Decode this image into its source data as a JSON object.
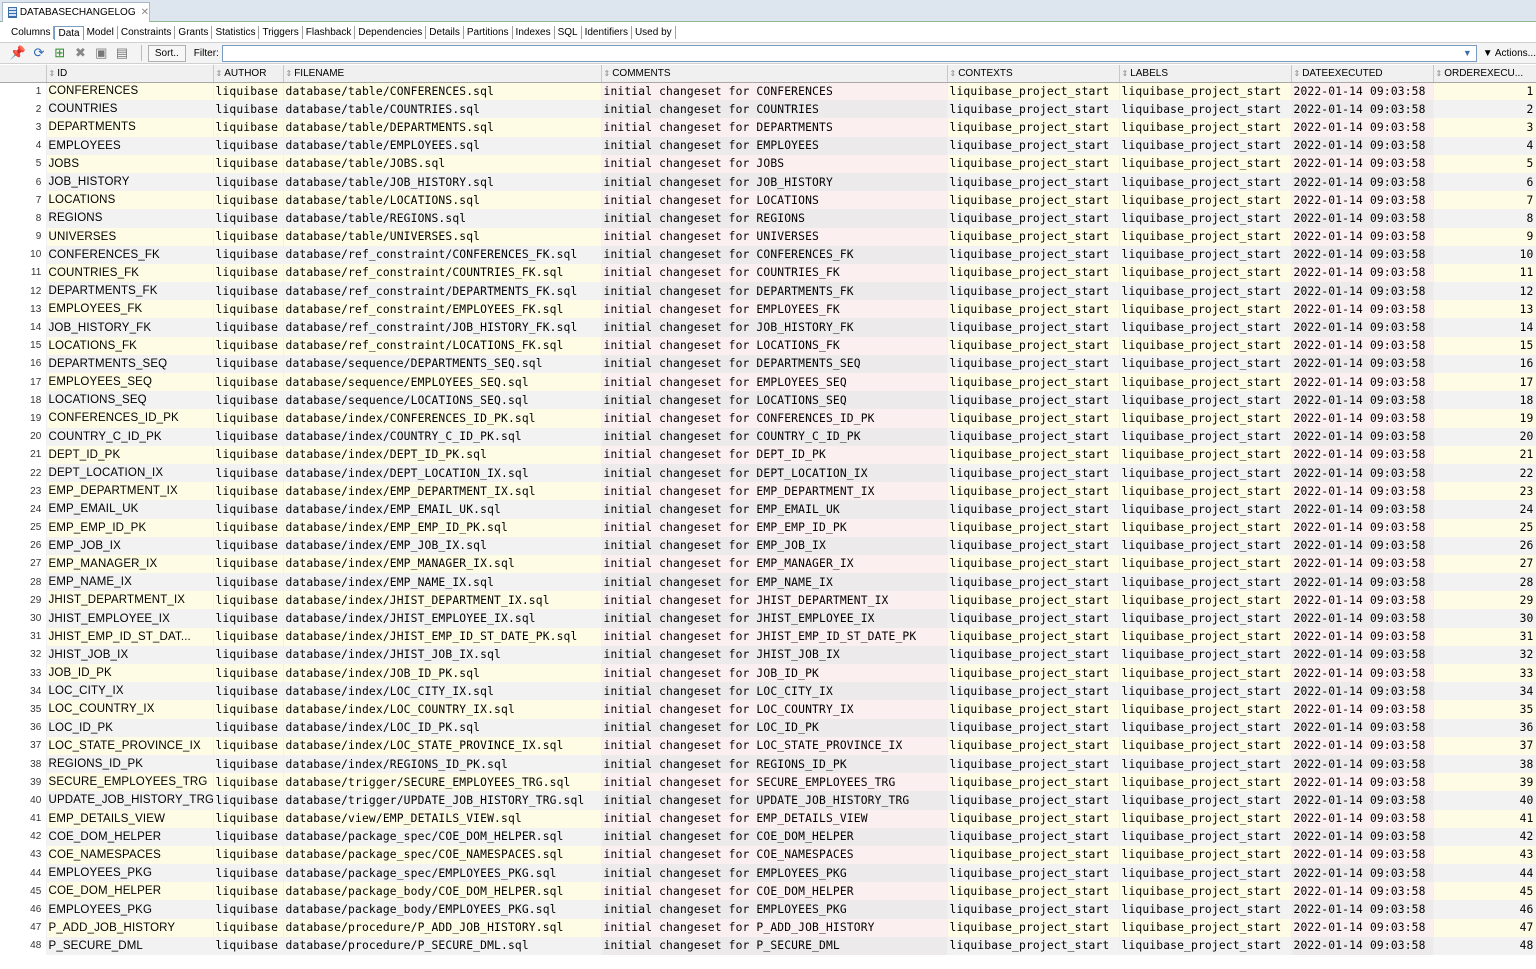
{
  "document_tab": {
    "title": "DATABASECHANGELOG"
  },
  "view_tabs": [
    "Columns",
    "Data",
    "Model",
    "Constraints",
    "Grants",
    "Statistics",
    "Triggers",
    "Flashback",
    "Dependencies",
    "Details",
    "Partitions",
    "Indexes",
    "SQL",
    "Identifiers",
    "Used by"
  ],
  "active_view_tab": "Data",
  "toolbar": {
    "sort_label": "Sort..",
    "filter_label": "Filter:",
    "filter_value": "",
    "actions_label": "Actions..."
  },
  "columns": [
    "ID",
    "AUTHOR",
    "FILENAME",
    "COMMENTS",
    "CONTEXTS",
    "LABELS",
    "DATEEXECUTED",
    "ORDEREXECU..."
  ],
  "rows": [
    {
      "n": "1",
      "id": "CONFERENCES",
      "author": "liquibase",
      "filename": "database/table/CONFERENCES.sql",
      "comments": "initial changeset for CONFERENCES",
      "contexts": "liquibase_project_start",
      "labels": "liquibase_project_start",
      "dateexecuted": "2022-01-14 09:03:58",
      "order": "1"
    },
    {
      "n": "2",
      "id": "COUNTRIES",
      "author": "liquibase",
      "filename": "database/table/COUNTRIES.sql",
      "comments": "initial changeset for COUNTRIES",
      "contexts": "liquibase_project_start",
      "labels": "liquibase_project_start",
      "dateexecuted": "2022-01-14 09:03:58",
      "order": "2"
    },
    {
      "n": "3",
      "id": "DEPARTMENTS",
      "author": "liquibase",
      "filename": "database/table/DEPARTMENTS.sql",
      "comments": "initial changeset for DEPARTMENTS",
      "contexts": "liquibase_project_start",
      "labels": "liquibase_project_start",
      "dateexecuted": "2022-01-14 09:03:58",
      "order": "3"
    },
    {
      "n": "4",
      "id": "EMPLOYEES",
      "author": "liquibase",
      "filename": "database/table/EMPLOYEES.sql",
      "comments": "initial changeset for EMPLOYEES",
      "contexts": "liquibase_project_start",
      "labels": "liquibase_project_start",
      "dateexecuted": "2022-01-14 09:03:58",
      "order": "4"
    },
    {
      "n": "5",
      "id": "JOBS",
      "author": "liquibase",
      "filename": "database/table/JOBS.sql",
      "comments": "initial changeset for JOBS",
      "contexts": "liquibase_project_start",
      "labels": "liquibase_project_start",
      "dateexecuted": "2022-01-14 09:03:58",
      "order": "5"
    },
    {
      "n": "6",
      "id": "JOB_HISTORY",
      "author": "liquibase",
      "filename": "database/table/JOB_HISTORY.sql",
      "comments": "initial changeset for JOB_HISTORY",
      "contexts": "liquibase_project_start",
      "labels": "liquibase_project_start",
      "dateexecuted": "2022-01-14 09:03:58",
      "order": "6"
    },
    {
      "n": "7",
      "id": "LOCATIONS",
      "author": "liquibase",
      "filename": "database/table/LOCATIONS.sql",
      "comments": "initial changeset for LOCATIONS",
      "contexts": "liquibase_project_start",
      "labels": "liquibase_project_start",
      "dateexecuted": "2022-01-14 09:03:58",
      "order": "7"
    },
    {
      "n": "8",
      "id": "REGIONS",
      "author": "liquibase",
      "filename": "database/table/REGIONS.sql",
      "comments": "initial changeset for REGIONS",
      "contexts": "liquibase_project_start",
      "labels": "liquibase_project_start",
      "dateexecuted": "2022-01-14 09:03:58",
      "order": "8"
    },
    {
      "n": "9",
      "id": "UNIVERSES",
      "author": "liquibase",
      "filename": "database/table/UNIVERSES.sql",
      "comments": "initial changeset for UNIVERSES",
      "contexts": "liquibase_project_start",
      "labels": "liquibase_project_start",
      "dateexecuted": "2022-01-14 09:03:58",
      "order": "9"
    },
    {
      "n": "10",
      "id": "CONFERENCES_FK",
      "author": "liquibase",
      "filename": "database/ref_constraint/CONFERENCES_FK.sql",
      "comments": "initial changeset for CONFERENCES_FK",
      "contexts": "liquibase_project_start",
      "labels": "liquibase_project_start",
      "dateexecuted": "2022-01-14 09:03:58",
      "order": "10"
    },
    {
      "n": "11",
      "id": "COUNTRIES_FK",
      "author": "liquibase",
      "filename": "database/ref_constraint/COUNTRIES_FK.sql",
      "comments": "initial changeset for COUNTRIES_FK",
      "contexts": "liquibase_project_start",
      "labels": "liquibase_project_start",
      "dateexecuted": "2022-01-14 09:03:58",
      "order": "11"
    },
    {
      "n": "12",
      "id": "DEPARTMENTS_FK",
      "author": "liquibase",
      "filename": "database/ref_constraint/DEPARTMENTS_FK.sql",
      "comments": "initial changeset for DEPARTMENTS_FK",
      "contexts": "liquibase_project_start",
      "labels": "liquibase_project_start",
      "dateexecuted": "2022-01-14 09:03:58",
      "order": "12"
    },
    {
      "n": "13",
      "id": "EMPLOYEES_FK",
      "author": "liquibase",
      "filename": "database/ref_constraint/EMPLOYEES_FK.sql",
      "comments": "initial changeset for EMPLOYEES_FK",
      "contexts": "liquibase_project_start",
      "labels": "liquibase_project_start",
      "dateexecuted": "2022-01-14 09:03:58",
      "order": "13"
    },
    {
      "n": "14",
      "id": "JOB_HISTORY_FK",
      "author": "liquibase",
      "filename": "database/ref_constraint/JOB_HISTORY_FK.sql",
      "comments": "initial changeset for JOB_HISTORY_FK",
      "contexts": "liquibase_project_start",
      "labels": "liquibase_project_start",
      "dateexecuted": "2022-01-14 09:03:58",
      "order": "14"
    },
    {
      "n": "15",
      "id": "LOCATIONS_FK",
      "author": "liquibase",
      "filename": "database/ref_constraint/LOCATIONS_FK.sql",
      "comments": "initial changeset for LOCATIONS_FK",
      "contexts": "liquibase_project_start",
      "labels": "liquibase_project_start",
      "dateexecuted": "2022-01-14 09:03:58",
      "order": "15"
    },
    {
      "n": "16",
      "id": "DEPARTMENTS_SEQ",
      "author": "liquibase",
      "filename": "database/sequence/DEPARTMENTS_SEQ.sql",
      "comments": "initial changeset for DEPARTMENTS_SEQ",
      "contexts": "liquibase_project_start",
      "labels": "liquibase_project_start",
      "dateexecuted": "2022-01-14 09:03:58",
      "order": "16"
    },
    {
      "n": "17",
      "id": "EMPLOYEES_SEQ",
      "author": "liquibase",
      "filename": "database/sequence/EMPLOYEES_SEQ.sql",
      "comments": "initial changeset for EMPLOYEES_SEQ",
      "contexts": "liquibase_project_start",
      "labels": "liquibase_project_start",
      "dateexecuted": "2022-01-14 09:03:58",
      "order": "17"
    },
    {
      "n": "18",
      "id": "LOCATIONS_SEQ",
      "author": "liquibase",
      "filename": "database/sequence/LOCATIONS_SEQ.sql",
      "comments": "initial changeset for LOCATIONS_SEQ",
      "contexts": "liquibase_project_start",
      "labels": "liquibase_project_start",
      "dateexecuted": "2022-01-14 09:03:58",
      "order": "18"
    },
    {
      "n": "19",
      "id": "CONFERENCES_ID_PK",
      "author": "liquibase",
      "filename": "database/index/CONFERENCES_ID_PK.sql",
      "comments": "initial changeset for CONFERENCES_ID_PK",
      "contexts": "liquibase_project_start",
      "labels": "liquibase_project_start",
      "dateexecuted": "2022-01-14 09:03:58",
      "order": "19"
    },
    {
      "n": "20",
      "id": "COUNTRY_C_ID_PK",
      "author": "liquibase",
      "filename": "database/index/COUNTRY_C_ID_PK.sql",
      "comments": "initial changeset for COUNTRY_C_ID_PK",
      "contexts": "liquibase_project_start",
      "labels": "liquibase_project_start",
      "dateexecuted": "2022-01-14 09:03:58",
      "order": "20"
    },
    {
      "n": "21",
      "id": "DEPT_ID_PK",
      "author": "liquibase",
      "filename": "database/index/DEPT_ID_PK.sql",
      "comments": "initial changeset for DEPT_ID_PK",
      "contexts": "liquibase_project_start",
      "labels": "liquibase_project_start",
      "dateexecuted": "2022-01-14 09:03:58",
      "order": "21"
    },
    {
      "n": "22",
      "id": "DEPT_LOCATION_IX",
      "author": "liquibase",
      "filename": "database/index/DEPT_LOCATION_IX.sql",
      "comments": "initial changeset for DEPT_LOCATION_IX",
      "contexts": "liquibase_project_start",
      "labels": "liquibase_project_start",
      "dateexecuted": "2022-01-14 09:03:58",
      "order": "22"
    },
    {
      "n": "23",
      "id": "EMP_DEPARTMENT_IX",
      "author": "liquibase",
      "filename": "database/index/EMP_DEPARTMENT_IX.sql",
      "comments": "initial changeset for EMP_DEPARTMENT_IX",
      "contexts": "liquibase_project_start",
      "labels": "liquibase_project_start",
      "dateexecuted": "2022-01-14 09:03:58",
      "order": "23"
    },
    {
      "n": "24",
      "id": "EMP_EMAIL_UK",
      "author": "liquibase",
      "filename": "database/index/EMP_EMAIL_UK.sql",
      "comments": "initial changeset for EMP_EMAIL_UK",
      "contexts": "liquibase_project_start",
      "labels": "liquibase_project_start",
      "dateexecuted": "2022-01-14 09:03:58",
      "order": "24"
    },
    {
      "n": "25",
      "id": "EMP_EMP_ID_PK",
      "author": "liquibase",
      "filename": "database/index/EMP_EMP_ID_PK.sql",
      "comments": "initial changeset for EMP_EMP_ID_PK",
      "contexts": "liquibase_project_start",
      "labels": "liquibase_project_start",
      "dateexecuted": "2022-01-14 09:03:58",
      "order": "25"
    },
    {
      "n": "26",
      "id": "EMP_JOB_IX",
      "author": "liquibase",
      "filename": "database/index/EMP_JOB_IX.sql",
      "comments": "initial changeset for EMP_JOB_IX",
      "contexts": "liquibase_project_start",
      "labels": "liquibase_project_start",
      "dateexecuted": "2022-01-14 09:03:58",
      "order": "26"
    },
    {
      "n": "27",
      "id": "EMP_MANAGER_IX",
      "author": "liquibase",
      "filename": "database/index/EMP_MANAGER_IX.sql",
      "comments": "initial changeset for EMP_MANAGER_IX",
      "contexts": "liquibase_project_start",
      "labels": "liquibase_project_start",
      "dateexecuted": "2022-01-14 09:03:58",
      "order": "27"
    },
    {
      "n": "28",
      "id": "EMP_NAME_IX",
      "author": "liquibase",
      "filename": "database/index/EMP_NAME_IX.sql",
      "comments": "initial changeset for EMP_NAME_IX",
      "contexts": "liquibase_project_start",
      "labels": "liquibase_project_start",
      "dateexecuted": "2022-01-14 09:03:58",
      "order": "28"
    },
    {
      "n": "29",
      "id": "JHIST_DEPARTMENT_IX",
      "author": "liquibase",
      "filename": "database/index/JHIST_DEPARTMENT_IX.sql",
      "comments": "initial changeset for JHIST_DEPARTMENT_IX",
      "contexts": "liquibase_project_start",
      "labels": "liquibase_project_start",
      "dateexecuted": "2022-01-14 09:03:58",
      "order": "29"
    },
    {
      "n": "30",
      "id": "JHIST_EMPLOYEE_IX",
      "author": "liquibase",
      "filename": "database/index/JHIST_EMPLOYEE_IX.sql",
      "comments": "initial changeset for JHIST_EMPLOYEE_IX",
      "contexts": "liquibase_project_start",
      "labels": "liquibase_project_start",
      "dateexecuted": "2022-01-14 09:03:58",
      "order": "30"
    },
    {
      "n": "31",
      "id": "JHIST_EMP_ID_ST_DAT...",
      "author": "liquibase",
      "filename": "database/index/JHIST_EMP_ID_ST_DATE_PK.sql",
      "comments": "initial changeset for JHIST_EMP_ID_ST_DATE_PK",
      "contexts": "liquibase_project_start",
      "labels": "liquibase_project_start",
      "dateexecuted": "2022-01-14 09:03:58",
      "order": "31"
    },
    {
      "n": "32",
      "id": "JHIST_JOB_IX",
      "author": "liquibase",
      "filename": "database/index/JHIST_JOB_IX.sql",
      "comments": "initial changeset for JHIST_JOB_IX",
      "contexts": "liquibase_project_start",
      "labels": "liquibase_project_start",
      "dateexecuted": "2022-01-14 09:03:58",
      "order": "32"
    },
    {
      "n": "33",
      "id": "JOB_ID_PK",
      "author": "liquibase",
      "filename": "database/index/JOB_ID_PK.sql",
      "comments": "initial changeset for JOB_ID_PK",
      "contexts": "liquibase_project_start",
      "labels": "liquibase_project_start",
      "dateexecuted": "2022-01-14 09:03:58",
      "order": "33"
    },
    {
      "n": "34",
      "id": "LOC_CITY_IX",
      "author": "liquibase",
      "filename": "database/index/LOC_CITY_IX.sql",
      "comments": "initial changeset for LOC_CITY_IX",
      "contexts": "liquibase_project_start",
      "labels": "liquibase_project_start",
      "dateexecuted": "2022-01-14 09:03:58",
      "order": "34"
    },
    {
      "n": "35",
      "id": "LOC_COUNTRY_IX",
      "author": "liquibase",
      "filename": "database/index/LOC_COUNTRY_IX.sql",
      "comments": "initial changeset for LOC_COUNTRY_IX",
      "contexts": "liquibase_project_start",
      "labels": "liquibase_project_start",
      "dateexecuted": "2022-01-14 09:03:58",
      "order": "35"
    },
    {
      "n": "36",
      "id": "LOC_ID_PK",
      "author": "liquibase",
      "filename": "database/index/LOC_ID_PK.sql",
      "comments": "initial changeset for LOC_ID_PK",
      "contexts": "liquibase_project_start",
      "labels": "liquibase_project_start",
      "dateexecuted": "2022-01-14 09:03:58",
      "order": "36"
    },
    {
      "n": "37",
      "id": "LOC_STATE_PROVINCE_IX",
      "author": "liquibase",
      "filename": "database/index/LOC_STATE_PROVINCE_IX.sql",
      "comments": "initial changeset for LOC_STATE_PROVINCE_IX",
      "contexts": "liquibase_project_start",
      "labels": "liquibase_project_start",
      "dateexecuted": "2022-01-14 09:03:58",
      "order": "37"
    },
    {
      "n": "38",
      "id": "REGIONS_ID_PK",
      "author": "liquibase",
      "filename": "database/index/REGIONS_ID_PK.sql",
      "comments": "initial changeset for REGIONS_ID_PK",
      "contexts": "liquibase_project_start",
      "labels": "liquibase_project_start",
      "dateexecuted": "2022-01-14 09:03:58",
      "order": "38"
    },
    {
      "n": "39",
      "id": "SECURE_EMPLOYEES_TRG",
      "author": "liquibase",
      "filename": "database/trigger/SECURE_EMPLOYEES_TRG.sql",
      "comments": "initial changeset for SECURE_EMPLOYEES_TRG",
      "contexts": "liquibase_project_start",
      "labels": "liquibase_project_start",
      "dateexecuted": "2022-01-14 09:03:58",
      "order": "39"
    },
    {
      "n": "40",
      "id": "UPDATE_JOB_HISTORY_TRG",
      "author": "liquibase",
      "filename": "database/trigger/UPDATE_JOB_HISTORY_TRG.sql",
      "comments": "initial changeset for UPDATE_JOB_HISTORY_TRG",
      "contexts": "liquibase_project_start",
      "labels": "liquibase_project_start",
      "dateexecuted": "2022-01-14 09:03:58",
      "order": "40"
    },
    {
      "n": "41",
      "id": "EMP_DETAILS_VIEW",
      "author": "liquibase",
      "filename": "database/view/EMP_DETAILS_VIEW.sql",
      "comments": "initial changeset for EMP_DETAILS_VIEW",
      "contexts": "liquibase_project_start",
      "labels": "liquibase_project_start",
      "dateexecuted": "2022-01-14 09:03:58",
      "order": "41"
    },
    {
      "n": "42",
      "id": "COE_DOM_HELPER",
      "author": "liquibase",
      "filename": "database/package_spec/COE_DOM_HELPER.sql",
      "comments": "initial changeset for COE_DOM_HELPER",
      "contexts": "liquibase_project_start",
      "labels": "liquibase_project_start",
      "dateexecuted": "2022-01-14 09:03:58",
      "order": "42"
    },
    {
      "n": "43",
      "id": "COE_NAMESPACES",
      "author": "liquibase",
      "filename": "database/package_spec/COE_NAMESPACES.sql",
      "comments": "initial changeset for COE_NAMESPACES",
      "contexts": "liquibase_project_start",
      "labels": "liquibase_project_start",
      "dateexecuted": "2022-01-14 09:03:58",
      "order": "43"
    },
    {
      "n": "44",
      "id": "EMPLOYEES_PKG",
      "author": "liquibase",
      "filename": "database/package_spec/EMPLOYEES_PKG.sql",
      "comments": "initial changeset for EMPLOYEES_PKG",
      "contexts": "liquibase_project_start",
      "labels": "liquibase_project_start",
      "dateexecuted": "2022-01-14 09:03:58",
      "order": "44"
    },
    {
      "n": "45",
      "id": "COE_DOM_HELPER",
      "author": "liquibase",
      "filename": "database/package_body/COE_DOM_HELPER.sql",
      "comments": "initial changeset for COE_DOM_HELPER",
      "contexts": "liquibase_project_start",
      "labels": "liquibase_project_start",
      "dateexecuted": "2022-01-14 09:03:58",
      "order": "45"
    },
    {
      "n": "46",
      "id": "EMPLOYEES_PKG",
      "author": "liquibase",
      "filename": "database/package_body/EMPLOYEES_PKG.sql",
      "comments": "initial changeset for EMPLOYEES_PKG",
      "contexts": "liquibase_project_start",
      "labels": "liquibase_project_start",
      "dateexecuted": "2022-01-14 09:03:58",
      "order": "46"
    },
    {
      "n": "47",
      "id": "P_ADD_JOB_HISTORY",
      "author": "liquibase",
      "filename": "database/procedure/P_ADD_JOB_HISTORY.sql",
      "comments": "initial changeset for P_ADD_JOB_HISTORY",
      "contexts": "liquibase_project_start",
      "labels": "liquibase_project_start",
      "dateexecuted": "2022-01-14 09:03:58",
      "order": "47"
    },
    {
      "n": "48",
      "id": "P_SECURE_DML",
      "author": "liquibase",
      "filename": "database/procedure/P_SECURE_DML.sql",
      "comments": "initial changeset for P_SECURE_DML",
      "contexts": "liquibase_project_start",
      "labels": "liquibase_project_start",
      "dateexecuted": "2022-01-14 09:03:58",
      "order": "48"
    }
  ]
}
